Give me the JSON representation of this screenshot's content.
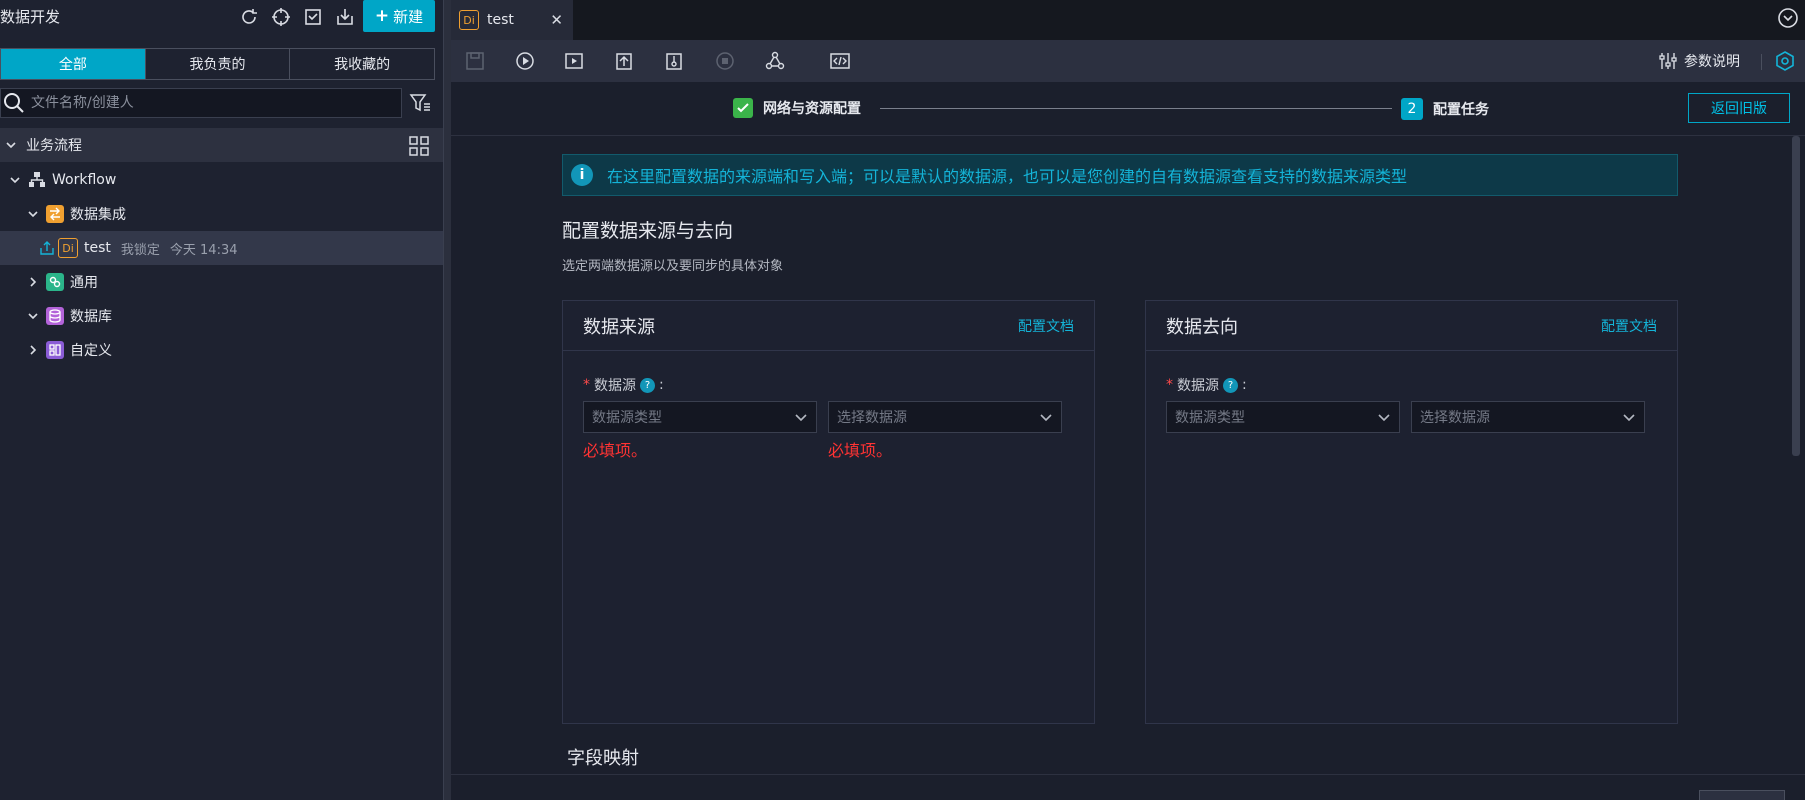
{
  "left_panel": {
    "title": "数据开发",
    "new_button": "新建",
    "tabs": [
      {
        "label": "全部",
        "active": true
      },
      {
        "label": "我负责的",
        "active": false
      },
      {
        "label": "我收藏的",
        "active": false
      }
    ],
    "search_placeholder": "文件名称/创建人",
    "section_label": "业务流程",
    "tree": {
      "workflow": "Workflow",
      "data_integration": "数据集成",
      "file_name": "test",
      "file_badge": "Di",
      "file_lock": "我锁定",
      "file_time": "今天 14:34",
      "general": "通用",
      "database": "数据库",
      "custom": "自定义"
    }
  },
  "editor": {
    "tab_label": "test",
    "tab_badge": "Di",
    "param_button": "参数说明",
    "steps": {
      "step1": "网络与资源配置",
      "step2_num": "2",
      "step2": "配置任务"
    },
    "back_button": "返回旧版",
    "info_text": "在这里配置数据的来源端和写入端；可以是默认的数据源，也可以是您创建的自有数据源查看支持的数据来源类型",
    "section_title": "配置数据来源与去向",
    "section_subtitle": "选定两端数据源以及要同步的具体对象",
    "source_card": {
      "title": "数据来源",
      "doc_link": "配置文档",
      "field_label": "数据源",
      "type_placeholder": "数据源类型",
      "source_placeholder": "选择数据源",
      "error_1": "必填项。",
      "error_2": "必填项。"
    },
    "target_card": {
      "title": "数据去向",
      "doc_link": "配置文档",
      "field_label": "数据源",
      "type_placeholder": "数据源类型",
      "source_placeholder": "选择数据源"
    },
    "mapping_title": "字段映射"
  },
  "colors": {
    "accent": "#00a6c7",
    "error": "#ff3333",
    "success": "#3bb44a",
    "badge": "#f0a030"
  }
}
